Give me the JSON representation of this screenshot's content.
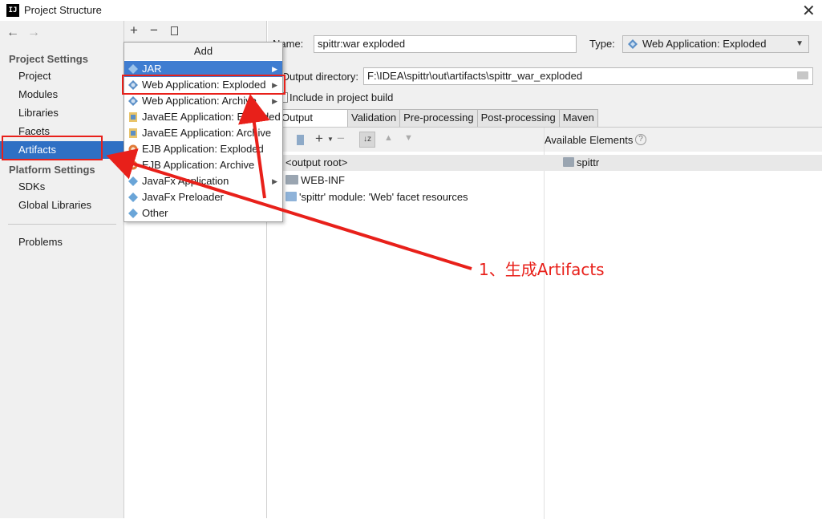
{
  "window": {
    "title": "Project Structure",
    "logo": "IJ"
  },
  "sidebar": {
    "project_settings_header": "Project Settings",
    "project_items": [
      "Project",
      "Modules",
      "Libraries",
      "Facets",
      "Artifacts"
    ],
    "platform_settings_header": "Platform Settings",
    "platform_items": [
      "SDKs",
      "Global Libraries"
    ],
    "problems": "Problems",
    "selected": "Artifacts"
  },
  "popup": {
    "header": "Add",
    "items": [
      "JAR",
      "Web Application: Exploded",
      "Web Application: Archive",
      "JavaEE Application: Exploded",
      "JavaEE Application: Archive",
      "EJB Application: Exploded",
      "EJB Application: Archive",
      "JavaFx Application",
      "JavaFx Preloader",
      "Other"
    ]
  },
  "artifact": {
    "name_label": "Name:",
    "name_value": "spittr:war exploded",
    "type_label": "Type:",
    "type_value": "Web Application: Exploded",
    "output_label": "Output directory:",
    "output_value": "F:\\IDEA\\spittr\\out\\artifacts\\spittr_war_exploded",
    "include_label": "Include in project build",
    "tabs": [
      "Output Layout",
      "Validation",
      "Pre-processing",
      "Post-processing",
      "Maven"
    ],
    "active_tab": "Output Layout",
    "available_label": "Available Elements",
    "tree_root": "<output root>",
    "tree_items": [
      "WEB-INF",
      "'spittr' module: 'Web' facet resources"
    ],
    "available_items": [
      "spittr"
    ]
  },
  "annotation": {
    "text": "1、生成Artifacts",
    "color": "#e8201a"
  },
  "colors": {
    "selection": "#2f70c4",
    "menu_highlight": "#3f7dd1",
    "annotation_red": "#e8201a"
  }
}
